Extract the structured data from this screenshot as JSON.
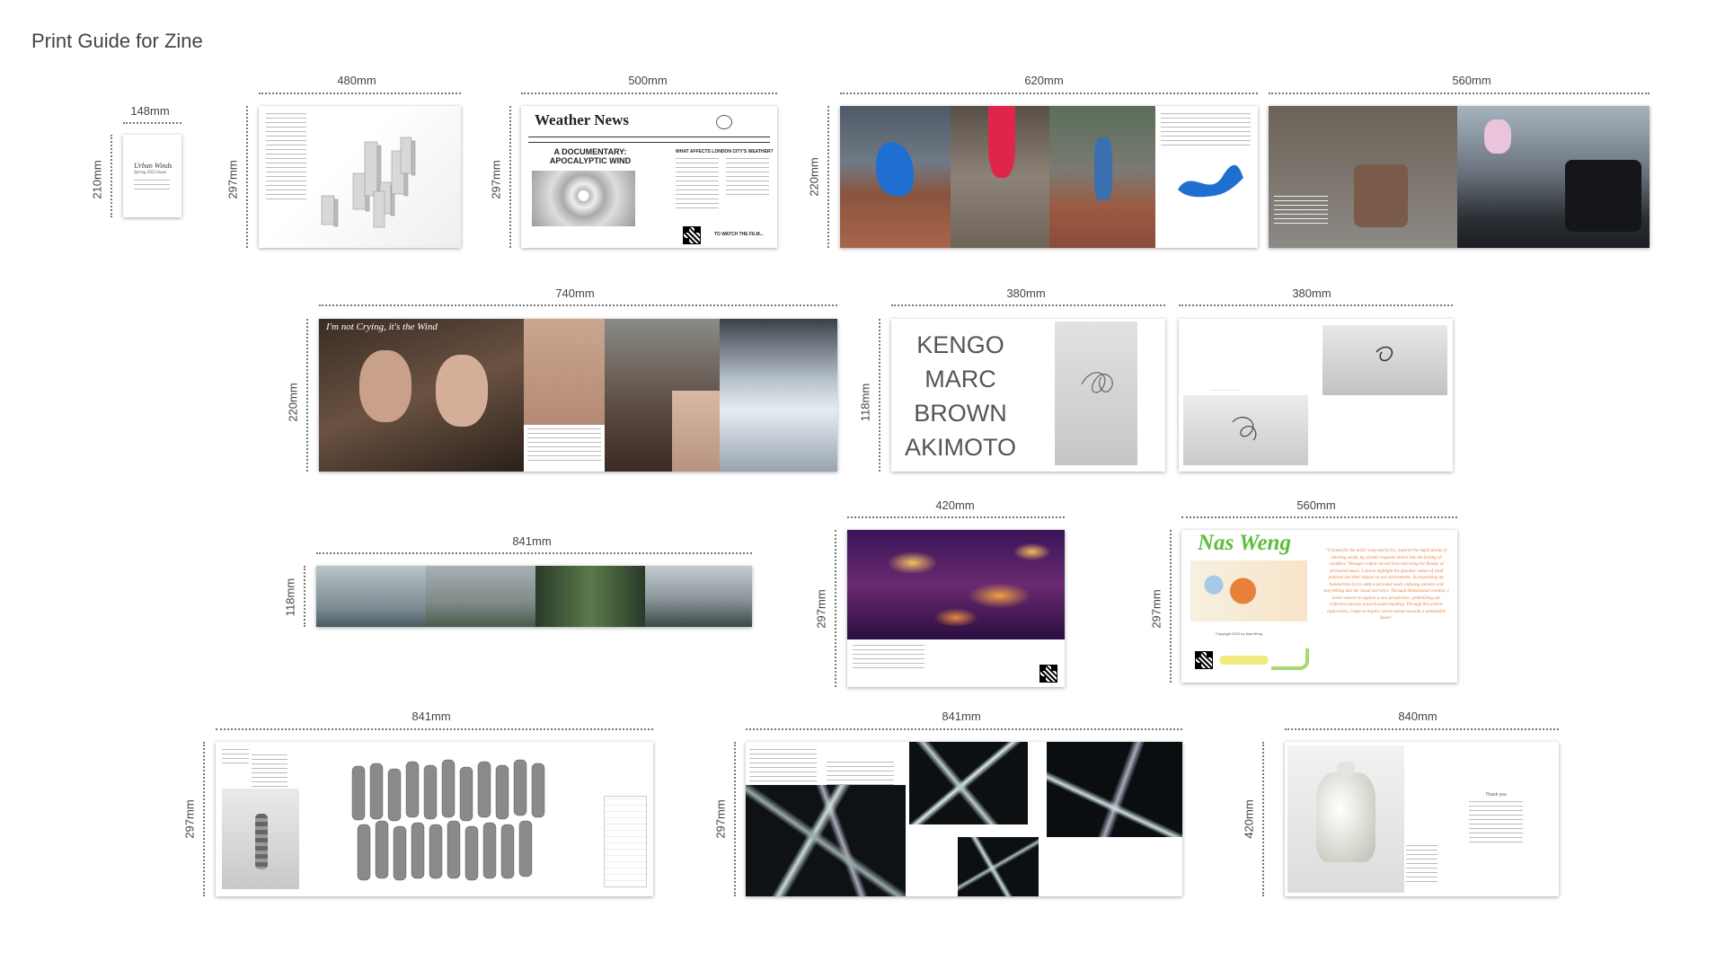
{
  "title": "Print Guide for Zine",
  "spreads": [
    {
      "width": "148mm",
      "height": "210mm"
    },
    {
      "width": "480mm",
      "height": "297mm"
    },
    {
      "width": "500mm",
      "height": "297mm"
    },
    {
      "width": "620mm",
      "height": "220mm"
    },
    {
      "width": "560mm"
    },
    {
      "width": "740mm",
      "height": "220mm"
    },
    {
      "width": "380mm",
      "height": "118mm"
    },
    {
      "width": "380mm"
    },
    {
      "width": "841mm",
      "height": "118mm"
    },
    {
      "width": "420mm",
      "height": "297mm"
    },
    {
      "width": "560mm",
      "height": "297mm"
    },
    {
      "width": "841mm",
      "height": "297mm"
    },
    {
      "width": "841mm",
      "height": "297mm"
    },
    {
      "width": "840mm",
      "height": "420mm"
    }
  ],
  "content": {
    "cover_title": "Urban Winds",
    "cover_subtitle": "Spring 2023 Issue",
    "weather_masthead": "Weather News",
    "weather_headline": "A DOCUMENTARY: APOCALYPTIC WIND",
    "weather_subhead": "WHAT AFFECTS LONDON CITY'S WEATHER?",
    "weather_cta": "TO WATCH THE FILM...",
    "cry_title": "I'm not Crying, it's the Wind",
    "kengo_lines": [
      "KENGO",
      "MARC",
      "BROWN",
      "AKIMOTO"
    ],
    "nas_title": "Nas Weng",
    "nas_quote": "\"Created for the artist' song and lyrics, inspired the implications of blowing winds, my artistic response delves into the feeling of windflow. Through crafted curved lines mirroring the fluidity of orchestral music, I aim to highlight the dynamic nature of wind patterns and their impact on our environment. Incorporating my handwritten lyrics adds a personal touch, infusing emotion and storytelling into the visual narrative. Through dimensional creation, I invite viewers to explore a new perspective, symbolizing our collective journey towards understanding. Through this artistic exploration, I hope to inspire conversations towards a sustainable future\"",
    "nas_copyright": "Copyright 2023 by Nas Weng",
    "thank_you": "Thank you"
  },
  "colors": {
    "nas_green": "#5cbf3a",
    "nas_orange": "#e8803a",
    "wind_blue": "#1f6fd0",
    "heat_purple": "#3a1457",
    "heat_orange": "#f0a040"
  }
}
